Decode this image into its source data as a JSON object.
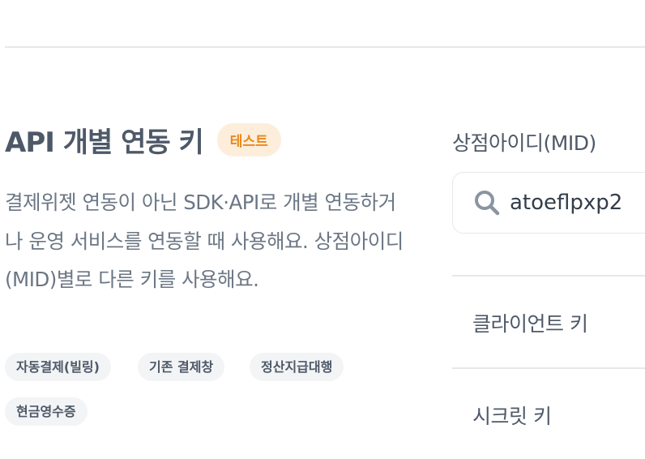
{
  "section": {
    "title": "API 개별 연동 키",
    "badge": "테스트",
    "description": "결제위젯 연동이 아닌 SDK·API로 개별 연동하거나 운영 서비스를 연동할 때 사용해요. 상점아이디(MID)별로 다른 키를 사용해요.",
    "chips": [
      "자동결제(빌링)",
      "기존 결제창",
      "정산지급대행",
      "현금영수증"
    ]
  },
  "mid": {
    "label": "상점아이디(MID)",
    "value": "atoeflpxp2"
  },
  "keys": {
    "client_key_label": "클라이언트 키",
    "secret_key_label": "시크릿 키"
  },
  "colors": {
    "badge_bg": "#fdeedc",
    "badge_text": "#e8891c",
    "chip_bg": "#f2f4f6",
    "divider": "#e5e8eb"
  }
}
